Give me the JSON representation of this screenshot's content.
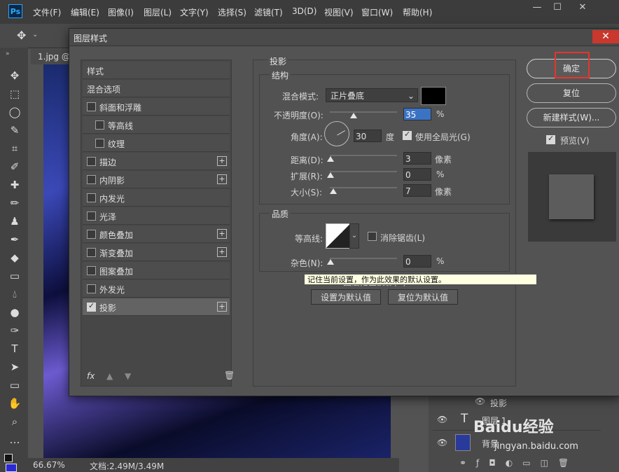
{
  "app": {
    "logo": "Ps"
  },
  "menu": [
    "文件(F)",
    "编辑(E)",
    "图像(I)",
    "图层(L)",
    "文字(Y)",
    "选择(S)",
    "滤镜(T)",
    "3D(D)",
    "视图(V)",
    "窗口(W)",
    "帮助(H)"
  ],
  "window_controls": {
    "minimize": "—",
    "maximize": "☐",
    "close": "✕"
  },
  "document": {
    "tab_label": "1.jpg @",
    "zoom": "66.67%",
    "doc_info": "文档:2.49M/3.49M"
  },
  "dialog": {
    "title": "图层样式",
    "styles_header": "样式",
    "blend_options": "混合选项",
    "style_items": [
      {
        "label": "斜面和浮雕",
        "checked": false,
        "indent": false,
        "plus": false,
        "selected": false
      },
      {
        "label": "等高线",
        "checked": false,
        "indent": true,
        "plus": false,
        "selected": false
      },
      {
        "label": "纹理",
        "checked": false,
        "indent": true,
        "plus": false,
        "selected": false
      },
      {
        "label": "描边",
        "checked": false,
        "indent": false,
        "plus": true,
        "selected": false
      },
      {
        "label": "内阴影",
        "checked": false,
        "indent": false,
        "plus": true,
        "selected": false
      },
      {
        "label": "内发光",
        "checked": false,
        "indent": false,
        "plus": false,
        "selected": false
      },
      {
        "label": "光泽",
        "checked": false,
        "indent": false,
        "plus": false,
        "selected": false
      },
      {
        "label": "颜色叠加",
        "checked": false,
        "indent": false,
        "plus": true,
        "selected": false
      },
      {
        "label": "渐变叠加",
        "checked": false,
        "indent": false,
        "plus": true,
        "selected": false
      },
      {
        "label": "图案叠加",
        "checked": false,
        "indent": false,
        "plus": false,
        "selected": false
      },
      {
        "label": "外发光",
        "checked": false,
        "indent": false,
        "plus": false,
        "selected": false
      },
      {
        "label": "投影",
        "checked": true,
        "indent": false,
        "plus": true,
        "selected": true
      }
    ],
    "fx_label": "fx",
    "section_title": "投影",
    "structure": {
      "title": "结构",
      "blend_mode_label": "混合模式:",
      "blend_mode_value": "正片叠底",
      "shadow_color": "#000000",
      "opacity_label": "不透明度(O):",
      "opacity_value": "35",
      "opacity_level": 35,
      "percent_unit": "%",
      "angle_label": "角度(A):",
      "angle_value": "30",
      "angle_unit": "度",
      "use_global_light_label": "使用全局光(G)",
      "use_global_light": true,
      "distance_label": "距离(D):",
      "distance_value": "3",
      "pixel_unit": "像素",
      "spread_label": "扩展(R):",
      "spread_value": "0",
      "size_label": "大小(S):",
      "size_value": "7"
    },
    "quality": {
      "title": "品质",
      "contour_label": "等高线:",
      "anti_alias_label": "消除锯齿(L)",
      "anti_alias": false,
      "noise_label": "杂色(N):",
      "noise_value": "0"
    },
    "knockout_label": "图层挖空投影(U)",
    "knockout": true,
    "set_default": "设置为默认值",
    "reset_default": "复位为默认值",
    "tooltip": "记住当前设置，作为此效果的默认设置。",
    "ok": "确定",
    "reset": "复位",
    "new_style": "新建样式(W)...",
    "preview_label": "预览(V)",
    "preview": true,
    "highlight_color": "#e8352a"
  },
  "layers": {
    "effect_label": "投影",
    "layer1": "图层 1",
    "background": "背景"
  },
  "watermark": {
    "brand": "Baidu经验",
    "url": "jingyan.baidu.com"
  }
}
